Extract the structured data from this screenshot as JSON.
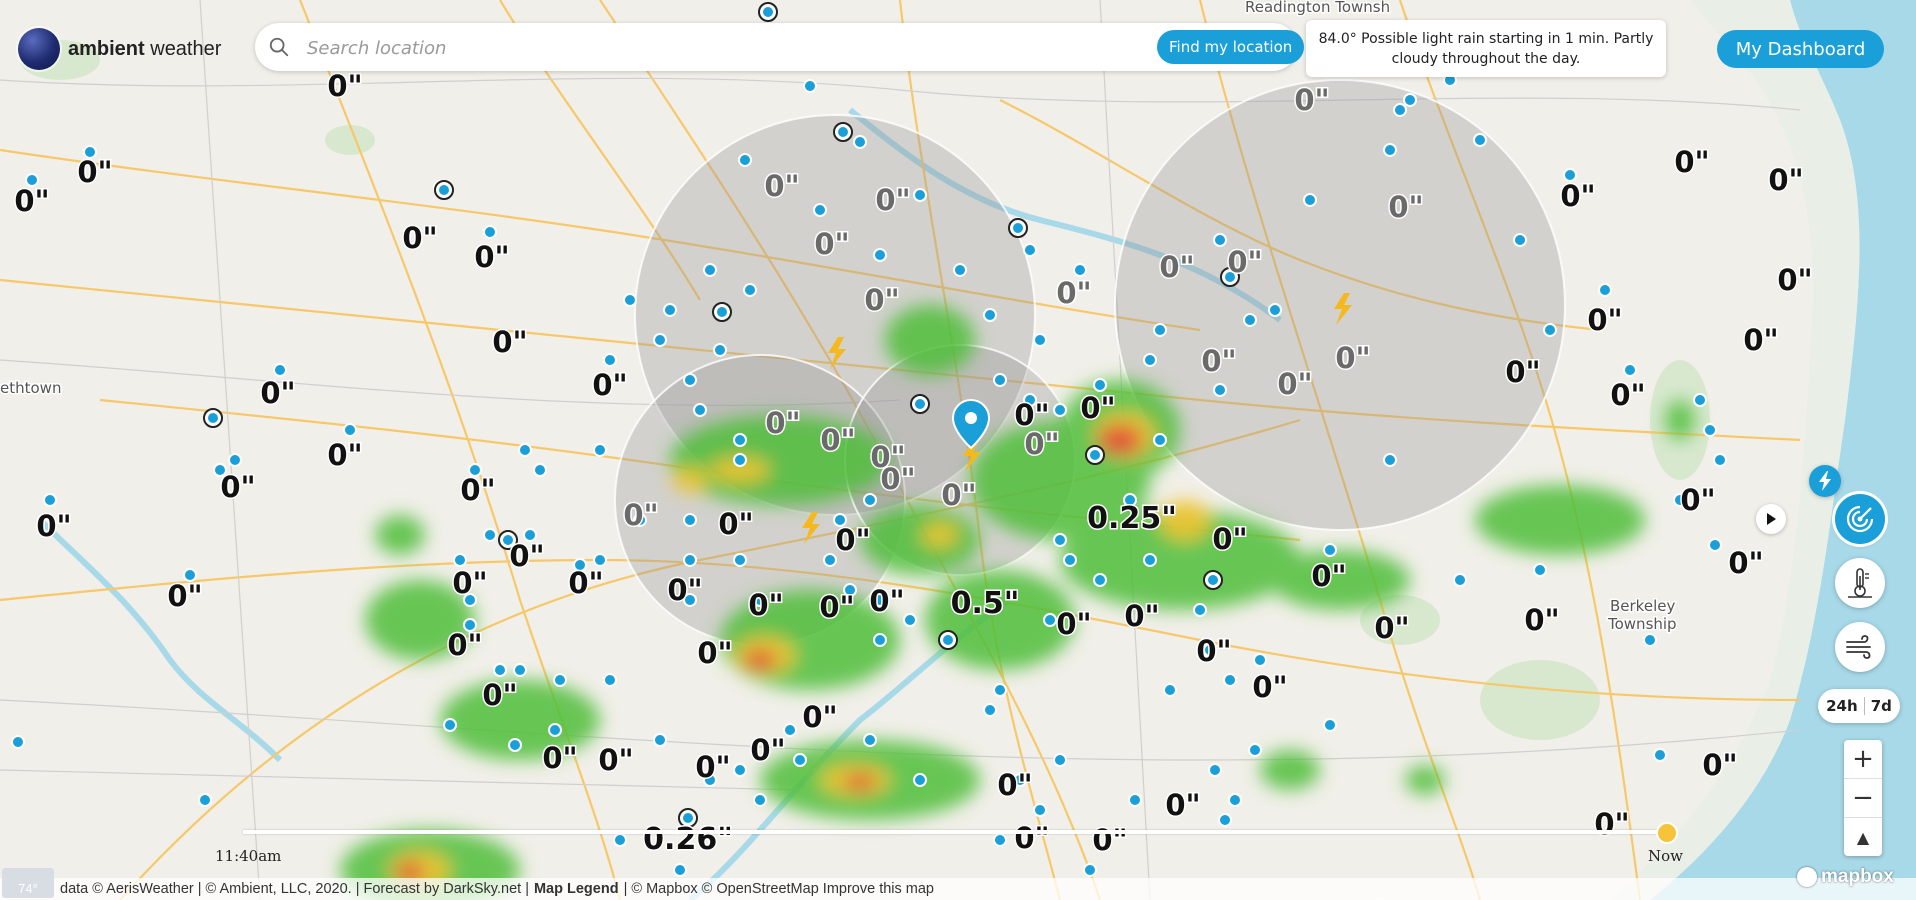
{
  "header": {
    "brand_bold": "ambient",
    "brand_rest": " weather",
    "search_placeholder": "Search location",
    "find_location_label": "Find my location",
    "forecast_text": "84.0° Possible light rain starting in 1 min. Partly cloudy throughout the day.",
    "dashboard_label": "My Dashboard"
  },
  "controls": {
    "range_24h": "24h",
    "range_7d": "7d",
    "zoom_in": "+",
    "zoom_out": "−",
    "compass": "▲"
  },
  "timeline": {
    "start_time": "11:40am",
    "end_label": "Now"
  },
  "attribution": {
    "temp_chip": "74°",
    "parts": [
      "data © AerisWeather | © Ambient, LLC, 2020. | Forecast by DarkSky.net |",
      "Map Legend",
      "| © Mapbox © OpenStreetMap  Improve this map"
    ],
    "mapbox": "mapbox"
  },
  "map_places": [
    "ethtown",
    "Readington Townsh",
    "Berkeley",
    "Township"
  ],
  "rain_readings": [
    "0\"",
    "0\"",
    "0\"",
    "0\"",
    "0\"",
    "0\"",
    "0\"",
    "0\"",
    "0\"",
    "0\"",
    "0\"",
    "0\"",
    "0\"",
    "0\"",
    "0\"",
    "0\"",
    "0\"",
    "0\"",
    "0\"",
    "0\"",
    "0\"",
    "0\"",
    "0\"",
    "0\"",
    "0\"",
    "0\"",
    "0\"",
    "0\"",
    "0\"",
    "0\"",
    "0\"",
    "0\"",
    "0\"",
    "0\"",
    "0\"",
    "0\"",
    "0\"",
    "0\"",
    "0\"",
    "0\"",
    "0\"",
    "0\"",
    "0\"",
    "0\"",
    "0\"",
    "0\"",
    "0\"",
    "0\"",
    "0\"",
    "0\"",
    "0\"",
    "0\"",
    "0\"",
    "0\"",
    "0\"",
    "0\"",
    "0\"",
    "0\"",
    "0\"",
    "0\"",
    "0\"",
    "0\"",
    "0\"",
    "0\"",
    "0.25\"",
    "0.5\"",
    "0.26\""
  ],
  "colors": {
    "accent": "#1b9fd8",
    "radar_green": "#4fbf3a",
    "radar_yellow": "#f2c531",
    "radar_red": "#e2463a",
    "lightning": "#f5b91e",
    "map_road": "#f7c86a"
  },
  "icons": {
    "search": "search-icon",
    "lightning": "lightning-icon",
    "play": "play-icon",
    "radar": "radar-icon",
    "temperature": "thermometer-icon",
    "wind": "wind-icon",
    "location": "location-pin-icon"
  }
}
